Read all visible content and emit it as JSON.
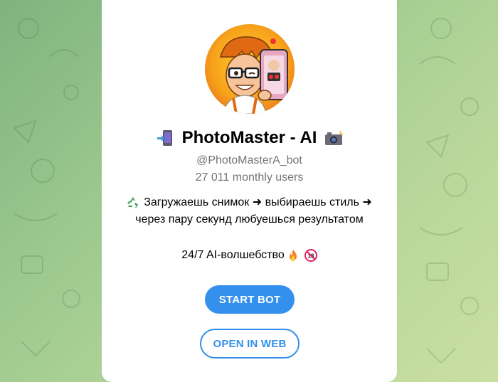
{
  "bot": {
    "title": "PhotoMaster - AI",
    "username": "@PhotoMasterA_bot",
    "monthly_users": "27 011 monthly users",
    "description_line1": "Загружаешь снимок ➜ выбираешь стиль ➜",
    "description_line2": "через пару секунд любуешься результатом",
    "tagline": "24/7 AI-волшебство"
  },
  "buttons": {
    "start_label": "START BOT",
    "web_label": "OPEN IN WEB"
  },
  "icons": {
    "title_left": "mobile-phone-arrow-icon",
    "title_right": "camera-flash-icon",
    "recycle": "recycle-icon",
    "fire": "fire-icon",
    "age_restriction": "no-under-18-icon"
  },
  "colors": {
    "accent": "#3390ec",
    "secondary_text": "#707579"
  }
}
